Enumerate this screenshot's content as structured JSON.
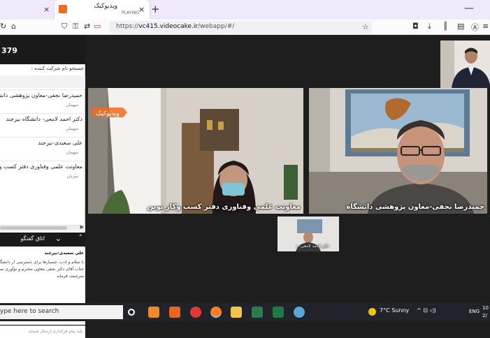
{
  "browser": {
    "tabs": [
      {
        "label": "",
        "close": "×"
      },
      {
        "label": "ویدیوکیک",
        "sub": "PLAYING",
        "close": "×"
      }
    ],
    "new_tab": "+",
    "minimize": "—",
    "url_prefix": "https://",
    "url_host": "vc415.videocake.ir",
    "url_path": "/webapp/#/"
  },
  "sidebar": {
    "room_id": "379",
    "search_placeholder": "جستجو نام شرکت کننده :",
    "participants": [
      {
        "name": "حمیدرضا نجفی-معاون پژوهشی دانشگاه",
        "role": "میهمان"
      },
      {
        "name": "دکتر احمد لامعی- دانشگاه بیرجند",
        "role": "میهمان"
      },
      {
        "name": "علی سعیدی-بیرجند",
        "role": "میهمان"
      },
      {
        "name": "معاونت علمی وفناوری دفتر کسب وکار",
        "role": "میزبان"
      }
    ],
    "chat": {
      "title": "اتاق گفتگو",
      "author": "علی سعیدی-بیرجند",
      "message": "با سلام و ادب، چسبارها برای دسترسی از دانشگاه بیرجند دسترسی داریم و جناب آقای دکتر نجفی معاون محترم و نوآوری نمی توانند وارد شوند. اگر مترجمت فرماید",
      "input_placeholder": "بلند پیام فرکذاری ارسال شماید"
    }
  },
  "videos": {
    "female_label": "معاونت علمی وفناوری دفتر کسب وکار نوین",
    "male_label": "حمیدرضا نجفی-معاون پژوهشی دانشگاه",
    "thumb_label": "دکتر احمد لامعی- د",
    "watermark": "ویدیوکیک"
  },
  "taskbar": {
    "search_placeholder": "ype here to search",
    "weather": "7°C  Sunny",
    "tray": "^  ⊡  ◁)",
    "lang": "ENG",
    "clock_line1": "10",
    "clock_line2": "2/"
  },
  "colors": {
    "browser_bg": "#f0e9fb",
    "accent_orange": "#f26b1d",
    "sidebar_header": "#1a1a1a",
    "taskbar": "#20232a"
  }
}
